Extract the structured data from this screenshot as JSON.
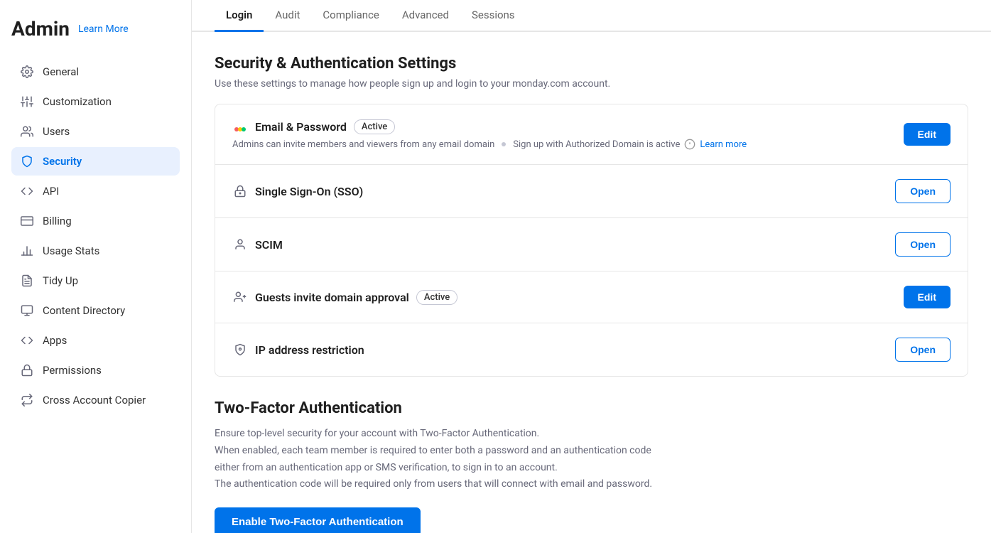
{
  "sidebar": {
    "title": "Admin",
    "learn_more": "Learn More",
    "items": [
      {
        "id": "general",
        "label": "General",
        "icon": "gear"
      },
      {
        "id": "customization",
        "label": "Customization",
        "icon": "sliders"
      },
      {
        "id": "users",
        "label": "Users",
        "icon": "users"
      },
      {
        "id": "security",
        "label": "Security",
        "icon": "shield",
        "active": true
      },
      {
        "id": "api",
        "label": "API",
        "icon": "api"
      },
      {
        "id": "billing",
        "label": "Billing",
        "icon": "credit-card"
      },
      {
        "id": "usage-stats",
        "label": "Usage Stats",
        "icon": "chart"
      },
      {
        "id": "tidy-up",
        "label": "Tidy Up",
        "icon": "tidy"
      },
      {
        "id": "content-directory",
        "label": "Content Directory",
        "icon": "content"
      },
      {
        "id": "apps",
        "label": "Apps",
        "icon": "code"
      },
      {
        "id": "permissions",
        "label": "Permissions",
        "icon": "lock"
      },
      {
        "id": "cross-account-copier",
        "label": "Cross Account Copier",
        "icon": "arrows"
      }
    ]
  },
  "tabs": [
    {
      "id": "login",
      "label": "Login",
      "active": true
    },
    {
      "id": "audit",
      "label": "Audit"
    },
    {
      "id": "compliance",
      "label": "Compliance"
    },
    {
      "id": "advanced",
      "label": "Advanced"
    },
    {
      "id": "sessions",
      "label": "Sessions"
    }
  ],
  "main": {
    "section_title": "Security & Authentication Settings",
    "section_desc": "Use these settings to manage how people sign up and login to your monday.com account.",
    "rows": [
      {
        "id": "email-password",
        "title": "Email & Password",
        "badge": "Active",
        "desc": "Admins can invite members and viewers from any email domain",
        "desc2": "Sign up with Authorized Domain is active",
        "learn_more": "Learn more",
        "button": "Edit",
        "button_type": "primary"
      },
      {
        "id": "sso",
        "title": "Single Sign-On (SSO)",
        "badge": null,
        "desc": null,
        "button": "Open",
        "button_type": "outline"
      },
      {
        "id": "scim",
        "title": "SCIM",
        "badge": null,
        "desc": null,
        "button": "Open",
        "button_type": "outline"
      },
      {
        "id": "guests-invite",
        "title": "Guests invite domain approval",
        "badge": "Active",
        "desc": null,
        "button": "Edit",
        "button_type": "primary"
      },
      {
        "id": "ip-restriction",
        "title": "IP address restriction",
        "badge": null,
        "desc": null,
        "button": "Open",
        "button_type": "outline"
      }
    ],
    "tfa": {
      "title": "Two-Factor Authentication",
      "desc1": "Ensure top-level security for your account with Two-Factor Authentication.",
      "desc2": "When enabled, each team member is required to enter both a password and an authentication code",
      "desc3": "either from an authentication app or SMS verification, to sign in to an account.",
      "desc4": "The authentication code will be required only from users that will connect with email and password.",
      "button": "Enable Two-Factor Authentication"
    }
  }
}
